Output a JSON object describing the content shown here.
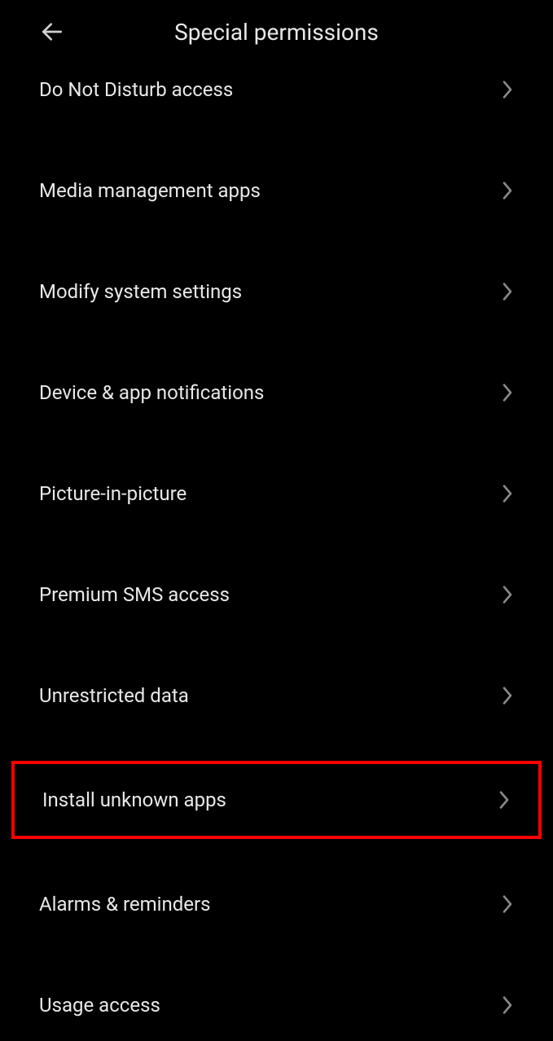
{
  "header": {
    "title": "Special permissions"
  },
  "items": [
    {
      "label": "Do Not Disturb access",
      "name": "item-do-not-disturb",
      "highlighted": false,
      "partial": true
    },
    {
      "label": "Media management apps",
      "name": "item-media-management",
      "highlighted": false
    },
    {
      "label": "Modify system settings",
      "name": "item-modify-system",
      "highlighted": false
    },
    {
      "label": "Device & app notifications",
      "name": "item-device-notifications",
      "highlighted": false
    },
    {
      "label": "Picture-in-picture",
      "name": "item-picture-in-picture",
      "highlighted": false
    },
    {
      "label": "Premium SMS access",
      "name": "item-premium-sms",
      "highlighted": false
    },
    {
      "label": "Unrestricted data",
      "name": "item-unrestricted-data",
      "highlighted": false
    },
    {
      "label": "Install unknown apps",
      "name": "item-install-unknown",
      "highlighted": true
    },
    {
      "label": "Alarms & reminders",
      "name": "item-alarms-reminders",
      "highlighted": false
    },
    {
      "label": "Usage access",
      "name": "item-usage-access",
      "highlighted": false
    }
  ]
}
